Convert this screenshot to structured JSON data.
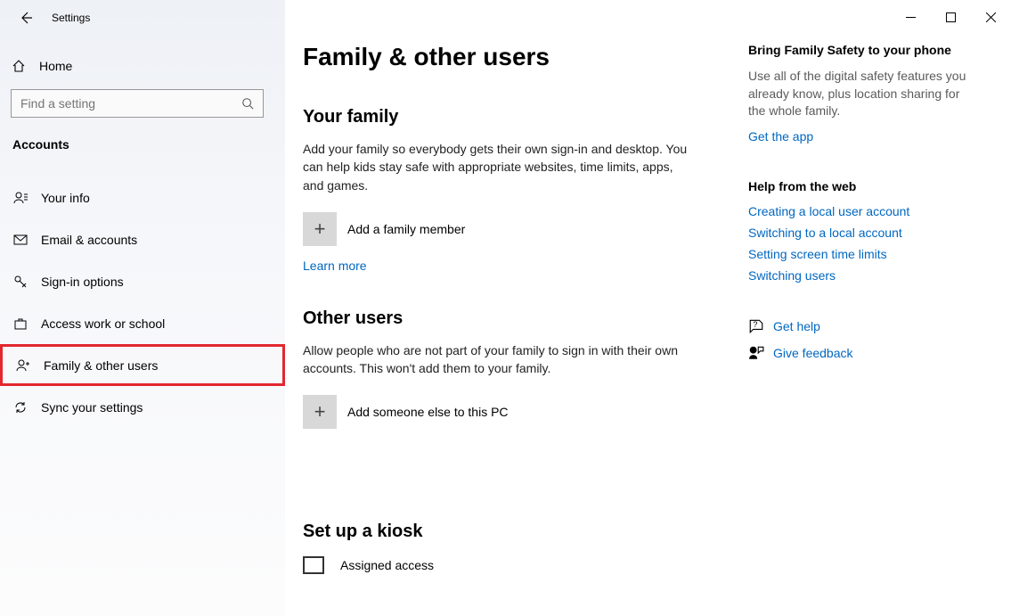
{
  "window": {
    "title": "Settings"
  },
  "sidebar": {
    "home": "Home",
    "search_placeholder": "Find a setting",
    "section": "Accounts",
    "items": [
      {
        "label": "Your info"
      },
      {
        "label": "Email & accounts"
      },
      {
        "label": "Sign-in options"
      },
      {
        "label": "Access work or school"
      },
      {
        "label": "Family & other users"
      },
      {
        "label": "Sync your settings"
      }
    ]
  },
  "page": {
    "title": "Family & other users",
    "family": {
      "heading": "Your family",
      "desc": "Add your family so everybody gets their own sign-in and desktop. You can help kids stay safe with appropriate websites, time limits, apps, and games.",
      "add_label": "Add a family member",
      "learn_more": "Learn more"
    },
    "others": {
      "heading": "Other users",
      "desc": "Allow people who are not part of your family to sign in with their own accounts. This won't add them to your family.",
      "add_label": "Add someone else to this PC"
    },
    "kiosk": {
      "heading": "Set up a kiosk",
      "assigned": "Assigned access"
    }
  },
  "right": {
    "safety": {
      "title": "Bring Family Safety to your phone",
      "desc": "Use all of the digital safety features you already know, plus location sharing for the whole family.",
      "link": "Get the app"
    },
    "help": {
      "title": "Help from the web",
      "links": [
        "Creating a local user account",
        "Switching to a local account",
        "Setting screen time limits",
        "Switching users"
      ]
    },
    "gethelp": "Get help",
    "feedback": "Give feedback"
  }
}
